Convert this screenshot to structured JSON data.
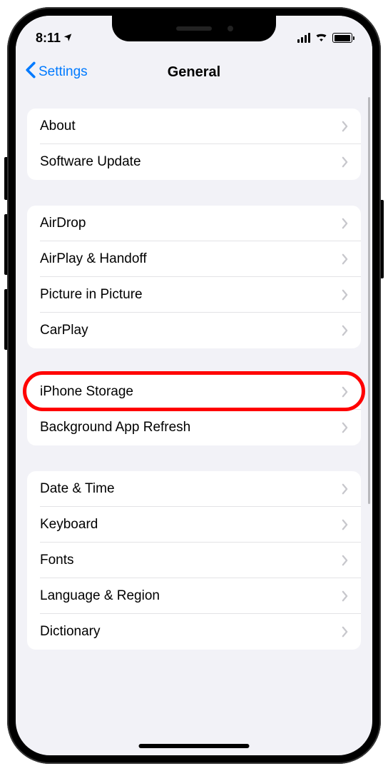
{
  "statusBar": {
    "time": "8:11"
  },
  "nav": {
    "back_label": "Settings",
    "title": "General"
  },
  "groups": [
    {
      "items": [
        {
          "label": "About",
          "name": "about"
        },
        {
          "label": "Software Update",
          "name": "software-update"
        }
      ]
    },
    {
      "items": [
        {
          "label": "AirDrop",
          "name": "airdrop"
        },
        {
          "label": "AirPlay & Handoff",
          "name": "airplay-handoff"
        },
        {
          "label": "Picture in Picture",
          "name": "picture-in-picture"
        },
        {
          "label": "CarPlay",
          "name": "carplay"
        }
      ]
    },
    {
      "items": [
        {
          "label": "iPhone Storage",
          "name": "iphone-storage",
          "highlighted": true
        },
        {
          "label": "Background App Refresh",
          "name": "background-app-refresh"
        }
      ]
    },
    {
      "items": [
        {
          "label": "Date & Time",
          "name": "date-time"
        },
        {
          "label": "Keyboard",
          "name": "keyboard"
        },
        {
          "label": "Fonts",
          "name": "fonts"
        },
        {
          "label": "Language & Region",
          "name": "language-region"
        },
        {
          "label": "Dictionary",
          "name": "dictionary"
        }
      ]
    }
  ]
}
